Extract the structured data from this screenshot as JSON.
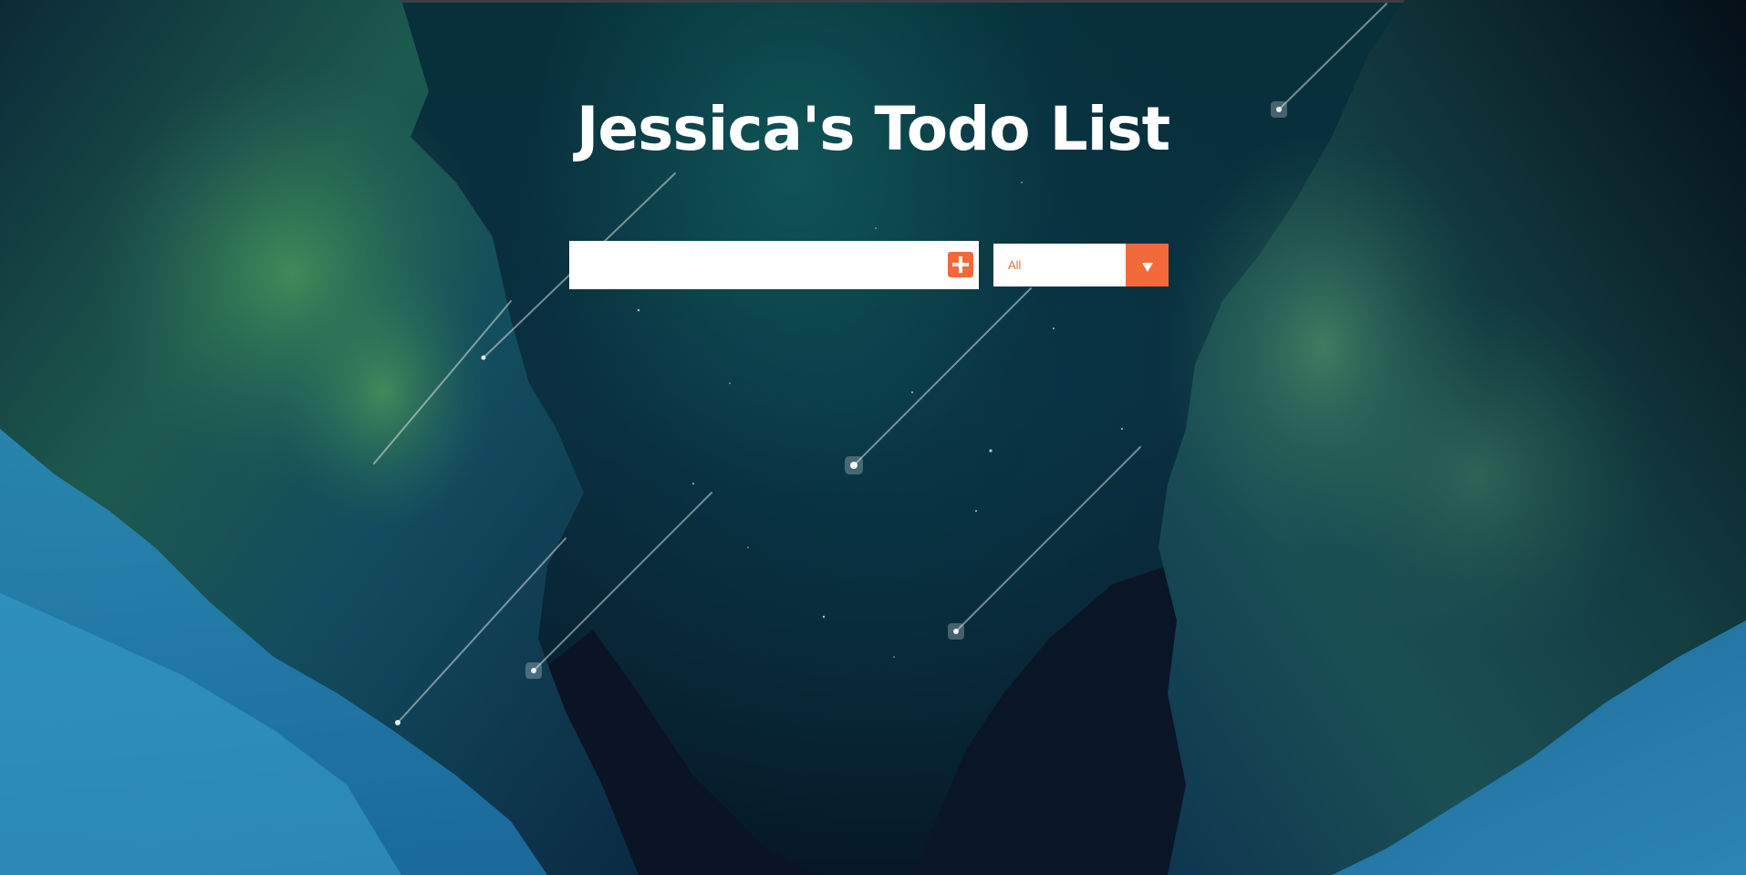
{
  "page": {
    "title": "Jessica's Todo List"
  },
  "todo_form": {
    "input_value": "",
    "input_placeholder": "",
    "add_icon": "plus-square-icon"
  },
  "filter": {
    "selected_value": "All",
    "icon": "chevron-down-icon"
  },
  "colors": {
    "accent": "#f26a3a",
    "title_text": "#ffffff",
    "field_background": "#ffffff"
  },
  "background": {
    "description": ""
  }
}
